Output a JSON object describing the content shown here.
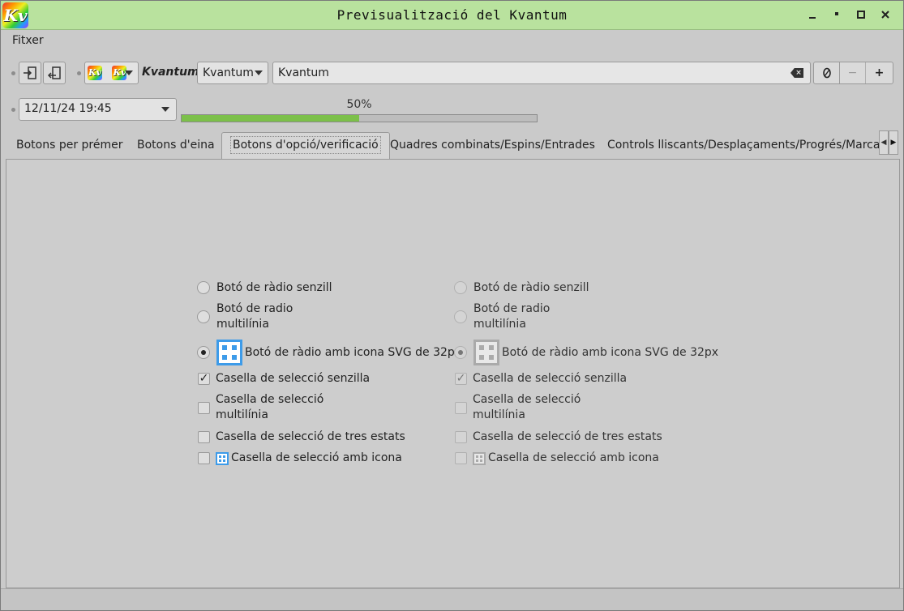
{
  "window": {
    "title": "Previsualització del Kvantum",
    "app_icon": "Kv"
  },
  "menu": {
    "items": [
      "Fitxer"
    ]
  },
  "toolbar": {
    "theme_label": "Kvantum",
    "style_combo_value": "Kvantum",
    "search_value": "Kvantum",
    "spin_minus": "−",
    "spin_plus": "+",
    "datetime_value": "12/11/24 19:45",
    "progress_text": "50%",
    "progress_value": 0.5
  },
  "tabs": [
    "Botons per prémer",
    "Botons d'eina",
    "Botons d'opció/verificació",
    "Quadres combinats/Espins/Entrades",
    "Controls lliscants/Desplaçaments/Progrés/Marcaci"
  ],
  "controls": {
    "radio_simple": "Botó de ràdio senzill",
    "radio_multi": "Botó de radio\nmultilínia",
    "radio_icon": "Botó de ràdio amb icona SVG de 32px",
    "check_simple": "Casella de selecció senzilla",
    "check_multi": "Casella de selecció\nmultilínia",
    "check_tristate": "Casella de selecció de tres estats",
    "check_icon": "Casella de selecció amb icona"
  },
  "colors": {
    "titlebar": "#b9e29e",
    "progress": "#7cc04a",
    "icon_blue": "#3d9be9"
  }
}
